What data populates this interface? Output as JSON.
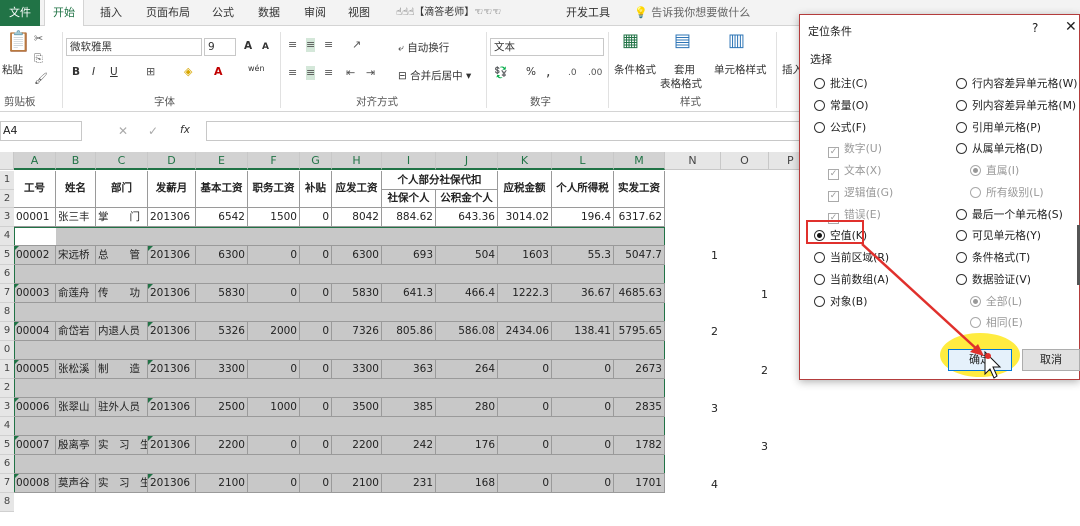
{
  "menu": {
    "file": "文件",
    "tabs": [
      "开始",
      "插入",
      "页面布局",
      "公式",
      "数据",
      "审阅",
      "视图",
      "☝☝☝【滴答老师】☜☜☜",
      "开发工具"
    ],
    "tellme": "告诉我你想要做什么"
  },
  "ribbon": {
    "clipboard": {
      "paste": "粘贴",
      "label": "剪贴板"
    },
    "font": {
      "name": "微软雅黑",
      "size": "9",
      "label": "字体",
      "bold": "B",
      "italic": "I",
      "underline": "U",
      "grow": "A",
      "shrink": "A",
      "wen": "wén"
    },
    "align": {
      "wrap": "自动换行",
      "merge": "合并后居中",
      "label": "对齐方式"
    },
    "number": {
      "format": "文本",
      "pct": "%",
      "comma": ",",
      "label": "数字"
    },
    "styles": {
      "cond": "条件格式",
      "table1": "套用",
      "table2": "表格格式",
      "cell": "单元格样式",
      "label": "样式"
    },
    "cells": {
      "insert": "插入"
    }
  },
  "formula": {
    "namebox": "A4",
    "fx": "fx",
    "cancel": "✕",
    "confirm": "✓"
  },
  "columns": [
    "A",
    "B",
    "C",
    "D",
    "E",
    "F",
    "G",
    "H",
    "I",
    "J",
    "K",
    "L",
    "M",
    "N",
    "O",
    "P"
  ],
  "rownums": [
    "1",
    "2",
    "3",
    "4",
    "5",
    "6",
    "7",
    "8",
    "9",
    "0",
    "1",
    "2",
    "3",
    "4",
    "5",
    "6",
    "7",
    "8"
  ],
  "headers": {
    "id": "工号",
    "name": "姓名",
    "dept": "部门",
    "month": "发薪月",
    "base": "基本工资",
    "duty": "职务工资",
    "bonus": "补贴",
    "gross": "应发工资",
    "group": "个人部分社保代扣",
    "ss": "社保个人",
    "hf": "公积金个人",
    "taxable": "应税金额",
    "tax": "个人所得税",
    "net": "实发工资"
  },
  "rows": [
    {
      "id": "00001",
      "name": "张三丰",
      "dept": "掌　　门",
      "month": "201306",
      "base": "6542",
      "duty": "1500",
      "bonus": "0",
      "gross": "8042",
      "ss": "884.62",
      "hf": "643.36",
      "taxable": "3014.02",
      "tax": "196.4",
      "net": "6317.62"
    },
    {
      "id": "00002",
      "name": "宋远桥",
      "dept": "总　　管",
      "month": "201306",
      "base": "6300",
      "duty": "0",
      "bonus": "0",
      "gross": "6300",
      "ss": "693",
      "hf": "504",
      "taxable": "1603",
      "tax": "55.3",
      "net": "5047.7"
    },
    {
      "id": "00003",
      "name": "俞莲舟",
      "dept": "传　　功",
      "month": "201306",
      "base": "5830",
      "duty": "0",
      "bonus": "0",
      "gross": "5830",
      "ss": "641.3",
      "hf": "466.4",
      "taxable": "1222.3",
      "tax": "36.67",
      "net": "4685.63"
    },
    {
      "id": "00004",
      "name": "俞岱岩",
      "dept": "内退人员",
      "month": "201306",
      "base": "5326",
      "duty": "2000",
      "bonus": "0",
      "gross": "7326",
      "ss": "805.86",
      "hf": "586.08",
      "taxable": "2434.06",
      "tax": "138.41",
      "net": "5795.65"
    },
    {
      "id": "00005",
      "name": "张松溪",
      "dept": "制　　造",
      "month": "201306",
      "base": "3300",
      "duty": "0",
      "bonus": "0",
      "gross": "3300",
      "ss": "363",
      "hf": "264",
      "taxable": "0",
      "tax": "0",
      "net": "2673"
    },
    {
      "id": "00006",
      "name": "张翠山",
      "dept": "驻外人员",
      "month": "201306",
      "base": "2500",
      "duty": "1000",
      "bonus": "0",
      "gross": "3500",
      "ss": "385",
      "hf": "280",
      "taxable": "0",
      "tax": "0",
      "net": "2835"
    },
    {
      "id": "00007",
      "name": "殷离亭",
      "dept": "实　习　生",
      "month": "201306",
      "base": "2200",
      "duty": "0",
      "bonus": "0",
      "gross": "2200",
      "ss": "242",
      "hf": "176",
      "taxable": "0",
      "tax": "0",
      "net": "1782"
    },
    {
      "id": "00008",
      "name": "莫声谷",
      "dept": "实　习　生",
      "month": "201306",
      "base": "2100",
      "duty": "0",
      "bonus": "0",
      "gross": "2100",
      "ss": "231",
      "hf": "168",
      "taxable": "0",
      "tax": "0",
      "net": "1701"
    }
  ],
  "aux": [
    "1",
    "1",
    "2",
    "2",
    "3",
    "3",
    "4"
  ],
  "dialog": {
    "title": "定位条件",
    "help": "?",
    "close": "✕",
    "section": "选择",
    "left": [
      "批注(C)",
      "常量(O)",
      "公式(F)",
      "数字(U)",
      "文本(X)",
      "逻辑值(G)",
      "错误(E)",
      "空值(K)",
      "当前区域(R)",
      "当前数组(A)",
      "对象(B)"
    ],
    "right": [
      "行内容差异单元格(W)",
      "列内容差异单元格(M)",
      "引用单元格(P)",
      "从属单元格(D)",
      "直属(I)",
      "所有级别(L)",
      "最后一个单元格(S)",
      "可见单元格(Y)",
      "条件格式(T)",
      "数据验证(V)",
      "全部(L)",
      "相同(E)"
    ],
    "ok": "确定",
    "cancel": "取消"
  }
}
